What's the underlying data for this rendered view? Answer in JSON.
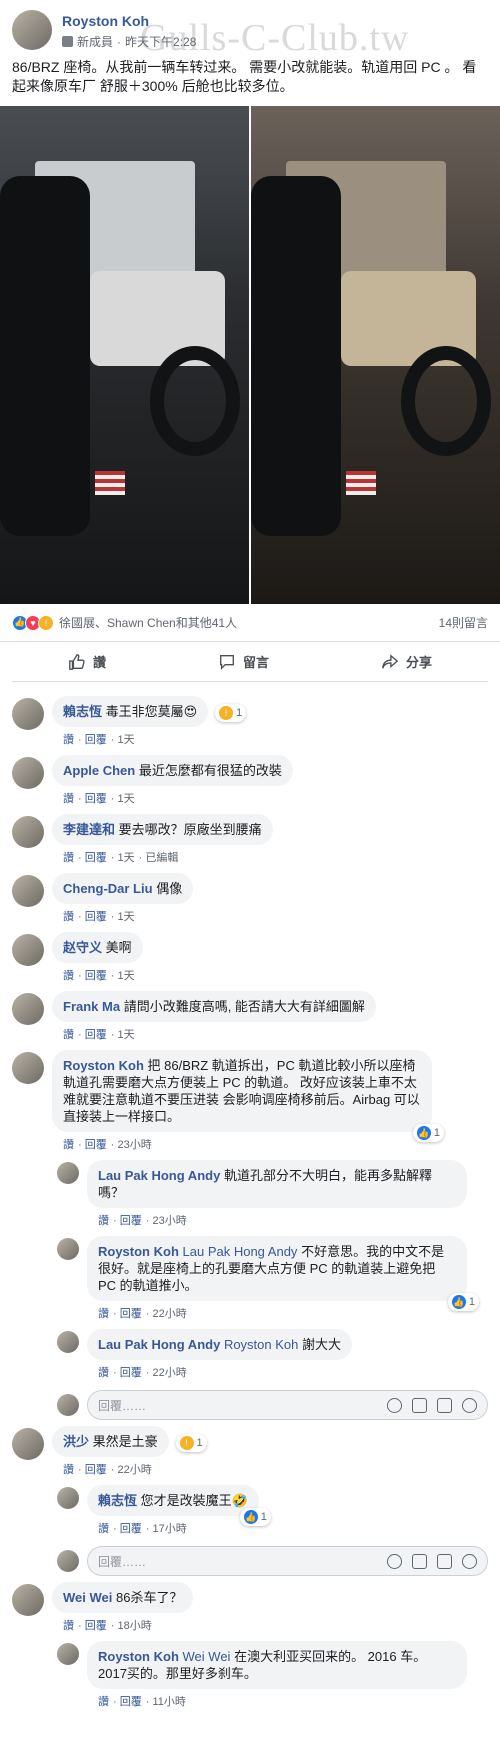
{
  "watermark": "Gulls-C-Club.tw",
  "post": {
    "author": "Royston Koh",
    "badge": "新成員",
    "time": "昨天下午2:28",
    "body": "86/BRZ 座椅。从我前一辆车转过来。 需要小改就能装。轨道用回 PC 。 看起来像原车厂 舒服＋300% 后舱也比较多位。"
  },
  "reactions": {
    "names": "徐國展、Shawn Chen和其他41人",
    "comment_count": "14則留言"
  },
  "actions": {
    "like": "讚",
    "comment": "留言",
    "share": "分享"
  },
  "labels": {
    "like": "讚",
    "reply": "回覆",
    "edited": "已編輯",
    "reply_placeholder": "回覆……"
  },
  "comments": [
    {
      "name": "賴志恆",
      "text": "毒王非您莫屬😍",
      "time": "1天",
      "react": "1"
    },
    {
      "name": "Apple Chen",
      "text": "最近怎麼都有很猛的改裝",
      "time": "1天"
    },
    {
      "name": "李建達和",
      "text": "要去哪改？原廠坐到腰痛",
      "time": "1天"
    },
    {
      "name": "Cheng-Dar Liu",
      "text": "偶像",
      "time": "1天"
    },
    {
      "name": "赵守义",
      "text": "美啊",
      "time": "1天"
    },
    {
      "name": "Frank Ma",
      "text": "請問小改難度高嗎, 能否請大大有詳細圖解",
      "time": "1天"
    },
    {
      "name": "Royston Koh",
      "text": "把 86/BRZ 軌道拆出，PC 軌道比較小所以座椅軌道孔需要磨大点方便装上 PC 的軌道。 改好应该装上車不太难就要注意軌道不要压进装 会影响调座椅移前后。Airbag 可以直接装上一样接口。",
      "time": "23小時",
      "react": "1"
    },
    {
      "name": "Lau Pak Hong Andy",
      "text": "軌道孔部分不大明白，能再多點解釋嗎？",
      "time": "23小時"
    },
    {
      "name": "Royston Koh",
      "tag": "Lau Pak Hong Andy",
      "text": "不好意思。我的中文不是很好。就是座椅上的孔要磨大点方便 PC 的軌道装上避免把 PC 的軌道推小。",
      "time": "22小時",
      "react": "1"
    },
    {
      "name": "Lau Pak Hong Andy",
      "tag": "Royston Koh",
      "text": "謝大大",
      "time": "22小時"
    },
    {
      "name": "洪少",
      "text": "果然是土豪",
      "time": "22小時",
      "react": "1"
    },
    {
      "name": "賴志恆",
      "text": "您才是改裝魔王🤣",
      "time": "17小時",
      "react": "1"
    },
    {
      "name": "Wei Wei",
      "text": "86杀车了？",
      "time": "18小時"
    },
    {
      "name": "Royston Koh",
      "tag": "Wei Wei",
      "text": "在澳大利亚买回来的。 2016 车。 2017买的。那里好多刹车。",
      "time": "11小時"
    }
  ]
}
